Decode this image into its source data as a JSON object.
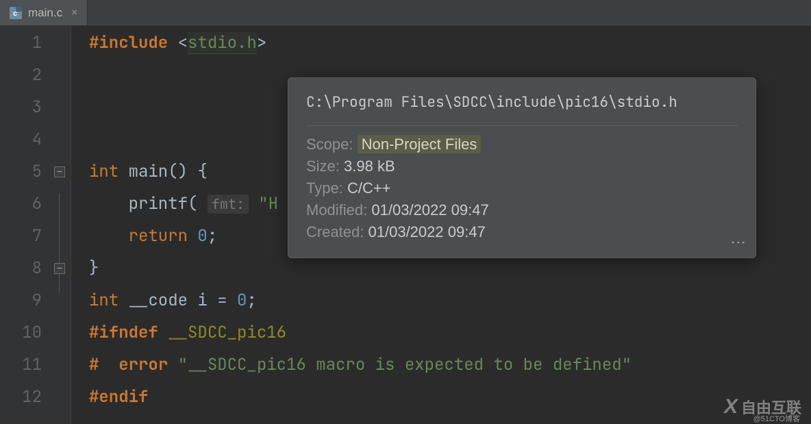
{
  "tab": {
    "filename": "main.c",
    "icon_name": "c-file-icon"
  },
  "gutter": {
    "lines": [
      "1",
      "2",
      "3",
      "4",
      "5",
      "6",
      "7",
      "8",
      "9",
      "10",
      "11",
      "12"
    ]
  },
  "code": {
    "l1": {
      "include": "#include",
      "open_angle": "<",
      "header": "stdio.h",
      "close_angle": ">"
    },
    "l5": {
      "kw_int": "int",
      "fn": "main",
      "parens": "()",
      "brace": " {"
    },
    "l6": {
      "fn": "printf",
      "open": "(",
      "hint_label": "fmt:",
      "str_open": " \"H"
    },
    "l7": {
      "kw_return": "return",
      "num": "0",
      "semi": ";"
    },
    "l8": {
      "brace_close": "}"
    },
    "l9": {
      "kw_int": "int",
      "qual": "__code",
      "ident": "i",
      "eq": "=",
      "num": "0",
      "semi": ";"
    },
    "l10": {
      "ifndef": "#ifndef",
      "macro": "__SDCC_pic16"
    },
    "l11": {
      "hash": "#",
      "errkw": "error",
      "msg": "\"__SDCC_pic16 macro is expected to be defined\""
    },
    "l12": {
      "endif": "#endif"
    }
  },
  "tooltip": {
    "path": "C:\\Program Files\\SDCC\\include\\pic16\\stdio.h",
    "scope_label": "Scope:",
    "scope_value": "Non-Project Files",
    "size_label": "Size:",
    "size_value": "3.98 kB",
    "type_label": "Type:",
    "type_value": "C/C++",
    "modified_label": "Modified:",
    "modified_value": "01/03/2022 09:47",
    "created_label": "Created:",
    "created_value": "01/03/2022 09:47"
  },
  "watermark": {
    "brand_text": "自由互联",
    "sub_text": "@51CTO博客"
  }
}
